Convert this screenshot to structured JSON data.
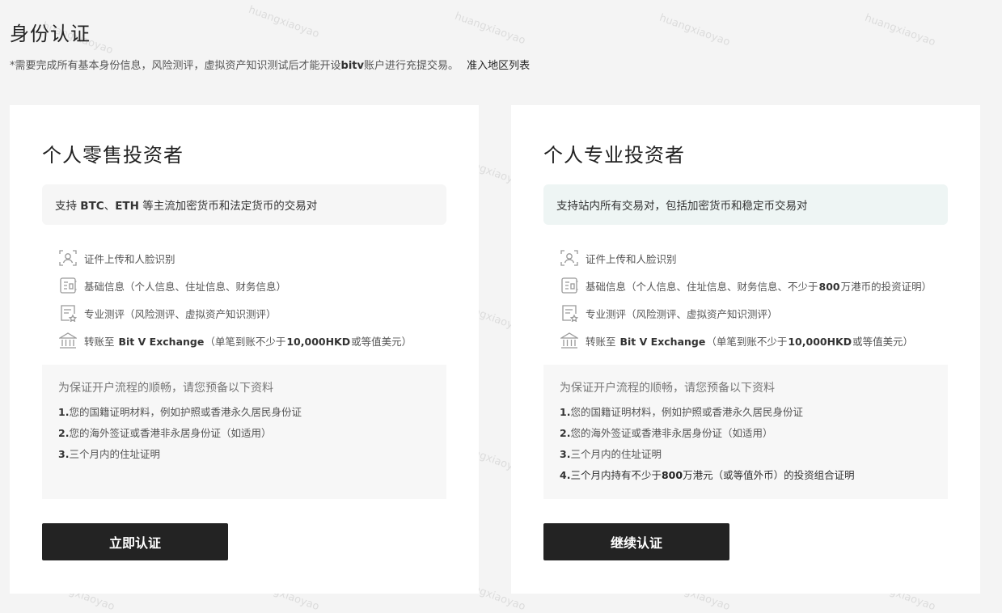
{
  "page": {
    "title": "身份认证",
    "notice_prefix": "*需要完成所有基本身份信息，风险测评，虚拟资产知识测试后才能开设",
    "notice_bold": "bitv",
    "notice_suffix": "账户进行充提交易。",
    "region_link": "准入地区列表"
  },
  "watermark": "huangxiaoyao",
  "cards": [
    {
      "title": "个人零售投资者",
      "scope": {
        "pre": "支持 ",
        "b1": "BTC",
        "mid1": "、",
        "b2": "ETH",
        "post": " 等主流加密货币和法定货币的交易对"
      },
      "requirements": {
        "id_upload": "证件上传和人脸识别",
        "basic_info": "基础信息（个人信息、住址信息、财务信息）",
        "assessment": "专业测评（风险测评、虚拟资产知识测评）",
        "transfer_pre": "转账至",
        "transfer_bank": "Bit V Exchange",
        "transfer_mid": "（单笔到账不少于",
        "transfer_amount": "10,000HKD",
        "transfer_post": "或等值美元）"
      },
      "prep": {
        "title": "为保证开户流程的顺畅，请您预备以下资料",
        "items": [
          {
            "num": "1.",
            "text": "您的国籍证明材料，例如护照或香港永久居民身份证"
          },
          {
            "num": "2.",
            "text": "您的海外签证或香港非永居身份证（如适用）"
          },
          {
            "num": "3.",
            "text": "三个月内的住址证明"
          }
        ]
      },
      "cta": "立即认证"
    },
    {
      "title": "个人专业投资者",
      "scope": {
        "text": "支持站内所有交易对，包括加密货币和稳定币交易对"
      },
      "requirements": {
        "id_upload": "证件上传和人脸识别",
        "basic_info_pre": "基础信息（个人信息、住址信息、财务信息、不少于",
        "basic_info_amount": "800",
        "basic_info_post": "万港币的投资证明）",
        "assessment": "专业测评（风险测评、虚拟资产知识测评）",
        "transfer_pre": "转账至",
        "transfer_bank": "Bit V Exchange",
        "transfer_mid": "（单笔到账不少于",
        "transfer_amount": "10,000HKD",
        "transfer_post": "或等值美元）"
      },
      "prep": {
        "title": "为保证开户流程的顺畅，请您预备以下资料",
        "items": [
          {
            "num": "1.",
            "text": "您的国籍证明材料，例如护照或香港永久居民身份证"
          },
          {
            "num": "2.",
            "text": "您的海外签证或香港非永居身份证（如适用）"
          },
          {
            "num": "3.",
            "text": "三个月内的住址证明"
          },
          {
            "num": "4.",
            "pre": "三个月内持有不少于",
            "amount": "800",
            "post": "万港元（或等值外币）的投资组合证明"
          }
        ]
      },
      "cta": "继续认证"
    }
  ],
  "icons": {
    "id_upload": "face-scan-icon",
    "basic_info": "info-form-icon",
    "assessment": "assessment-doc-icon",
    "transfer": "bank-icon"
  }
}
